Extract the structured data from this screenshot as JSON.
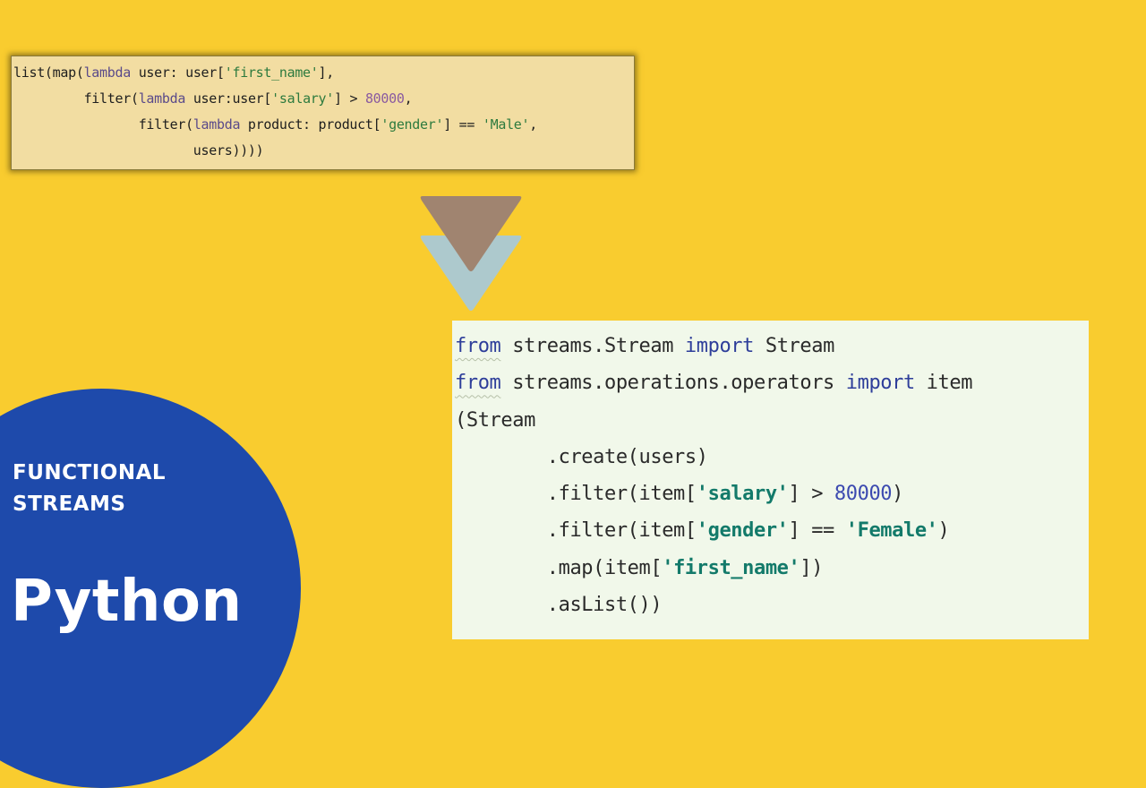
{
  "colors": {
    "background": "#f9cc2f",
    "circle": "#1e4aab",
    "arrow_top": "#a08470",
    "arrow_bottom": "#adc9cd",
    "top_code_bg": "#f2dda2",
    "bottom_code_bg": "#f1f8ea"
  },
  "top_code": {
    "lines": [
      [
        {
          "t": "list(map(",
          "c": ""
        },
        {
          "t": "lambda",
          "c": "kw"
        },
        {
          "t": " user: user[",
          "c": ""
        },
        {
          "t": "'first_name'",
          "c": "str"
        },
        {
          "t": "],",
          "c": ""
        }
      ],
      [
        {
          "t": "         filter(",
          "c": ""
        },
        {
          "t": "lambda",
          "c": "kw"
        },
        {
          "t": " user:user[",
          "c": ""
        },
        {
          "t": "'salary'",
          "c": "str"
        },
        {
          "t": "] > ",
          "c": ""
        },
        {
          "t": "80000",
          "c": "num"
        },
        {
          "t": ",",
          "c": ""
        }
      ],
      [
        {
          "t": "                filter(",
          "c": ""
        },
        {
          "t": "lambda",
          "c": "kw"
        },
        {
          "t": " product: product[",
          "c": ""
        },
        {
          "t": "'gender'",
          "c": "str"
        },
        {
          "t": "] == ",
          "c": ""
        },
        {
          "t": "'Male'",
          "c": "str"
        },
        {
          "t": ",",
          "c": ""
        }
      ],
      [
        {
          "t": "                       users))))",
          "c": ""
        }
      ]
    ]
  },
  "arrow_icon": "double-chevron-down-icon",
  "bottom_code": {
    "lines": [
      [
        {
          "t": "from",
          "c": "kw"
        },
        {
          "t": " streams.Stream ",
          "c": ""
        },
        {
          "t": "import",
          "c": "kw2"
        },
        {
          "t": " Stream",
          "c": ""
        }
      ],
      [
        {
          "t": "from",
          "c": "kw"
        },
        {
          "t": " streams.operations.operators ",
          "c": ""
        },
        {
          "t": "import",
          "c": "kw2"
        },
        {
          "t": " item",
          "c": ""
        }
      ],
      [
        {
          "t": "(Stream",
          "c": ""
        }
      ],
      [
        {
          "t": "        .create(users)",
          "c": ""
        }
      ],
      [
        {
          "t": "        .filter(item[",
          "c": ""
        },
        {
          "t": "'salary'",
          "c": "str"
        },
        {
          "t": "] > ",
          "c": ""
        },
        {
          "t": "80000",
          "c": "num"
        },
        {
          "t": ")",
          "c": ""
        }
      ],
      [
        {
          "t": "        .filter(item[",
          "c": ""
        },
        {
          "t": "'gender'",
          "c": "str"
        },
        {
          "t": "] == ",
          "c": ""
        },
        {
          "t": "'Female'",
          "c": "str"
        },
        {
          "t": ")",
          "c": ""
        }
      ],
      [
        {
          "t": "        .map(item[",
          "c": ""
        },
        {
          "t": "'first_name'",
          "c": "str"
        },
        {
          "t": "])",
          "c": ""
        }
      ],
      [
        {
          "t": "        .asList())",
          "c": ""
        }
      ]
    ]
  },
  "badge": {
    "subtitle_line1": "FUNCTIONAL",
    "subtitle_line2": "STREAMS",
    "title": "Python"
  }
}
